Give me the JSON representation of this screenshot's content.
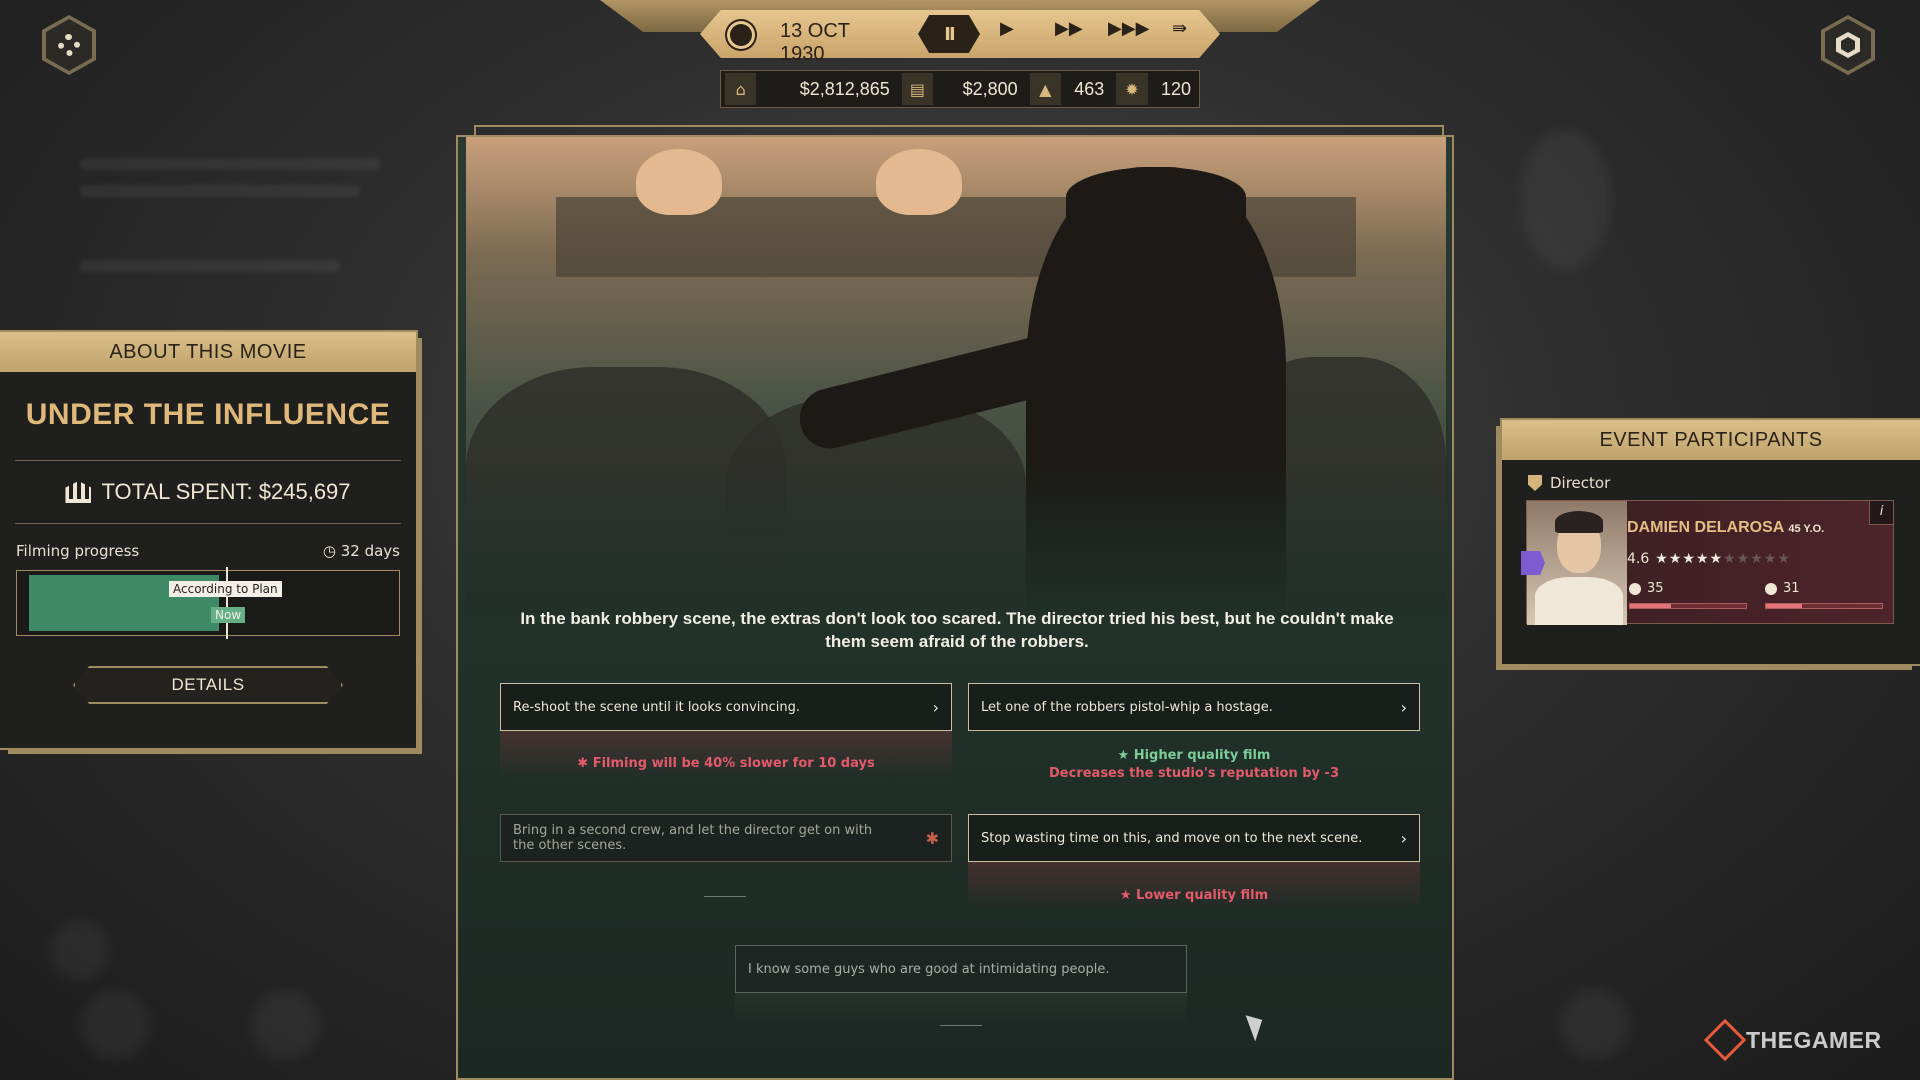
{
  "top_bar": {
    "date": "13 OCT 1930",
    "speed_controls": {
      "pause": "II",
      "play": "▶",
      "fast": "▶▶",
      "faster": "▶▶▶",
      "skip": "⇛"
    },
    "resources": [
      {
        "icon": "bank-icon",
        "value": "$2,812,865"
      },
      {
        "icon": "cash-stack-icon",
        "value": "$2,800"
      },
      {
        "icon": "reputation-icon",
        "value": "463"
      },
      {
        "icon": "star-icon",
        "value": "120"
      }
    ]
  },
  "about_movie": {
    "header": "ABOUT THIS MOVIE",
    "title": "UNDER THE INFLUENCE",
    "total_spent": "TOTAL SPENT: $245,697",
    "progress_label": "Filming progress",
    "days": "32 days",
    "progress_fraction": 0.62,
    "plan_tag": "According to Plan",
    "now_tag": "Now",
    "details_button": "DETAILS"
  },
  "event": {
    "narrative": "In the bank robbery scene, the extras don't look too scared. The director tried his best, but he couldn't make them seem afraid of the robbers.",
    "choices": [
      {
        "label": "Re-shoot the scene until it looks convincing.",
        "effects": [
          "Filming will be 40% slower for 10 days"
        ],
        "effect_tone": "negative",
        "enabled": true
      },
      {
        "label": "Let one of the robbers pistol-whip a hostage.",
        "effects": [
          "Higher quality film",
          "Decreases the studio's reputation by -3"
        ],
        "effect_tone": "mixed",
        "enabled": true
      },
      {
        "label": "Bring in a second crew, and let the director get on with the other scenes.",
        "effects": [],
        "enabled": false
      },
      {
        "label": "Stop wasting time on this, and move on to the next scene.",
        "effects": [
          "Lower quality film"
        ],
        "effect_tone": "negative",
        "enabled": true
      }
    ],
    "aside_option": "I know some guys who are good at intimidating people."
  },
  "participants": {
    "header": "EVENT PARTICIPANTS",
    "role": "Director",
    "name": "DAMIEN DELAROSA",
    "age": "45 Y.O.",
    "rating": "4.6",
    "stars_filled": 4.5,
    "stars_total": 10,
    "stat1_value": "35",
    "stat1_fraction": 0.35,
    "stat2_value": "31",
    "stat2_fraction": 0.31,
    "info_label": "i"
  },
  "watermark": "THEGAMER",
  "colors": {
    "gold": "#d9bf8a",
    "panel": "#1f1f1d",
    "positive": "#7ccc9a",
    "negative": "#e45a6a",
    "progress": "#3f8a66"
  }
}
